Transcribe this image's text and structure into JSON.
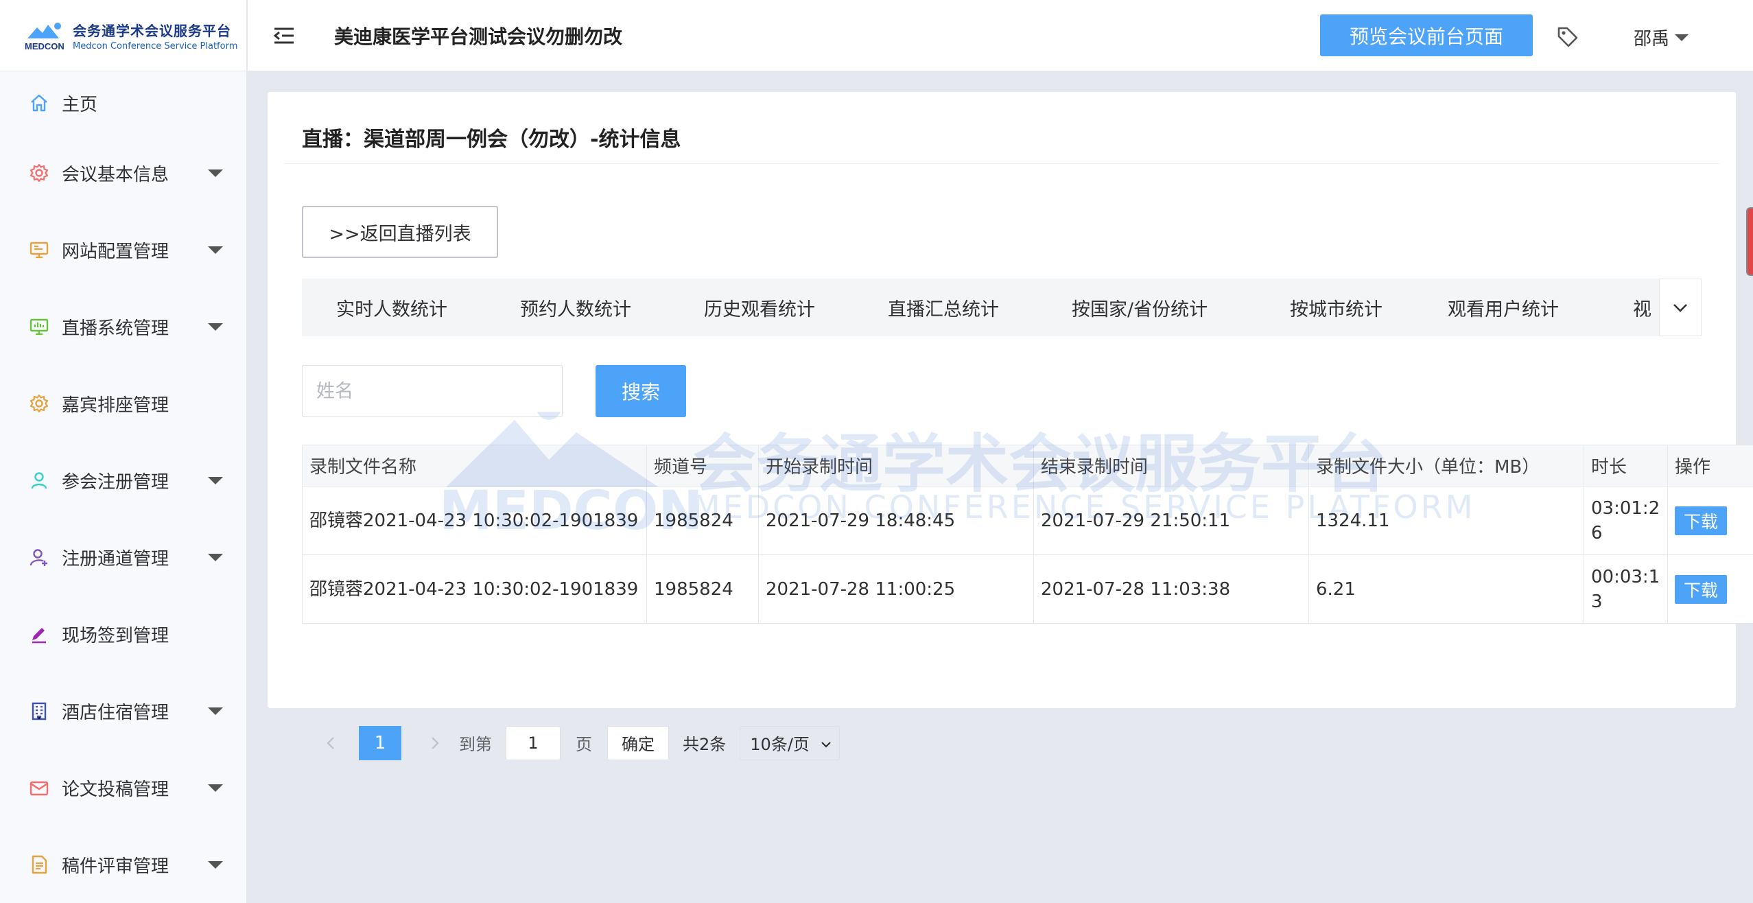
{
  "logo": {
    "cn": "会务通学术会议服务平台",
    "en": "Medcon Conference Service Platform",
    "mark": "MEDCON"
  },
  "sidebar": {
    "items": [
      {
        "label": "主页",
        "icon": "home-icon",
        "color": "#4da3f8",
        "has_caret": false
      },
      {
        "label": "会议基本信息",
        "icon": "gear-icon",
        "color": "#f56c6c",
        "has_caret": true
      },
      {
        "label": "网站配置管理",
        "icon": "monitor-icon",
        "color": "#e6a23c",
        "has_caret": true
      },
      {
        "label": "直播系统管理",
        "icon": "broadcast-icon",
        "color": "#67c23a",
        "has_caret": true
      },
      {
        "label": "嘉宾排座管理",
        "icon": "gear-icon",
        "color": "#e6a23c",
        "has_caret": false
      },
      {
        "label": "参会注册管理",
        "icon": "user-icon",
        "color": "#36cfc9",
        "has_caret": true
      },
      {
        "label": "注册通道管理",
        "icon": "user-add-icon",
        "color": "#7e57c2",
        "has_caret": true
      },
      {
        "label": "现场签到管理",
        "icon": "pen-icon",
        "color": "#9c27b0",
        "has_caret": false
      },
      {
        "label": "酒店住宿管理",
        "icon": "building-icon",
        "color": "#3f51b5",
        "has_caret": true
      },
      {
        "label": "论文投稿管理",
        "icon": "mail-icon",
        "color": "#f56c6c",
        "has_caret": true
      },
      {
        "label": "稿件评审管理",
        "icon": "document-icon",
        "color": "#e6a23c",
        "has_caret": true
      }
    ]
  },
  "header": {
    "title": "美迪康医学平台测试会议勿删勿改",
    "preview_label": "预览会议前台页面",
    "user": "邵禹"
  },
  "card": {
    "title": "直播：渠道部周一例会（勿改）-统计信息",
    "back_label": ">>返回直播列表"
  },
  "tabs": [
    "实时人数统计",
    "预约人数统计",
    "历史观看统计",
    "直播汇总统计",
    "按国家/省份统计",
    "按城市统计",
    "观看用户统计",
    "视"
  ],
  "search": {
    "placeholder": "姓名",
    "value": "",
    "button": "搜索"
  },
  "table": {
    "headers": [
      "录制文件名称",
      "频道号",
      "开始录制时间",
      "结束录制时间",
      "录制文件大小（单位：MB）",
      "时长",
      "操作"
    ],
    "rows": [
      {
        "name": "邵镜蓉2021-04-23 10:30:02-1901839",
        "channel": "1985824",
        "start": "2021-07-29 18:48:45",
        "end": "2021-07-29 21:50:11",
        "size": "1324.11",
        "duration": "03:01:26",
        "action": "下载"
      },
      {
        "name": "邵镜蓉2021-04-23 10:30:02-1901839",
        "channel": "1985824",
        "start": "2021-07-28 11:00:25",
        "end": "2021-07-28 11:03:38",
        "size": "6.21",
        "duration": "00:03:13",
        "action": "下载"
      }
    ]
  },
  "pager": {
    "current": "1",
    "goto_label": "到第",
    "goto_value": "1",
    "page_label": "页",
    "confirm_label": "确定",
    "total_label": "共2条",
    "page_size": "10条/页"
  },
  "watermark": {
    "cn": "会务通学术会议服务平台",
    "en": "MEDCON CONFERENCE SERVICE PLATFORM",
    "mark": "MEDCON"
  },
  "colors": {
    "primary": "#4da3f8",
    "page_bg": "#e5e8ef",
    "tab_bg": "#f4f5f7"
  }
}
